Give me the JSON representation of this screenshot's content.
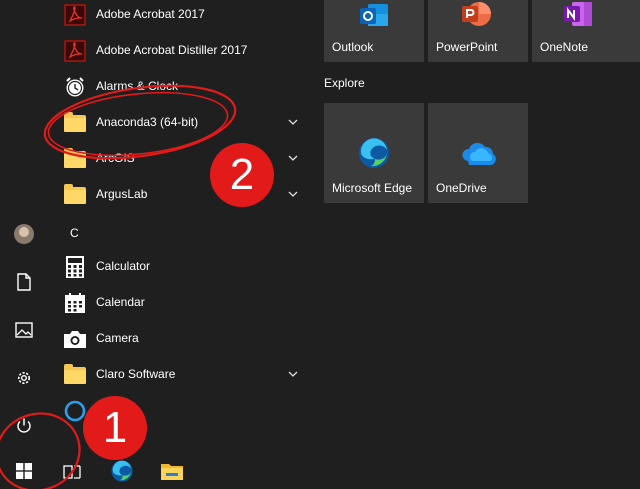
{
  "apps": [
    {
      "label": "Adobe Acrobat 2017",
      "icon": "acrobat-icon"
    },
    {
      "label": "Adobe Acrobat Distiller 2017",
      "icon": "acrobat-distiller-icon"
    },
    {
      "label": "Alarms & Clock",
      "icon": "alarm-clock-icon"
    },
    {
      "label": "Anaconda3 (64-bit)",
      "icon": "folder-icon"
    },
    {
      "label": "ArcGIS",
      "icon": "folder-icon"
    },
    {
      "label": "ArgusLab",
      "icon": "folder-icon"
    },
    {
      "label": "Calculator",
      "icon": "calculator-icon"
    },
    {
      "label": "Calendar",
      "icon": "calendar-icon"
    },
    {
      "label": "Camera",
      "icon": "camera-icon"
    },
    {
      "label": "Claro Software",
      "icon": "folder-icon"
    }
  ],
  "letter_header": "C",
  "tiles": {
    "outlook": "Outlook",
    "powerpoint": "PowerPoint",
    "onenote": "OneNote",
    "explore_header": "Explore",
    "edge": "Microsoft Edge",
    "onedrive": "OneDrive"
  },
  "annotations": {
    "badge1": "1",
    "badge2": "2"
  },
  "colors": {
    "background": "#1f1f1f",
    "tile": "#3a3a3a",
    "annotation_red": "#e21a1a",
    "folder": "#f6c552"
  }
}
